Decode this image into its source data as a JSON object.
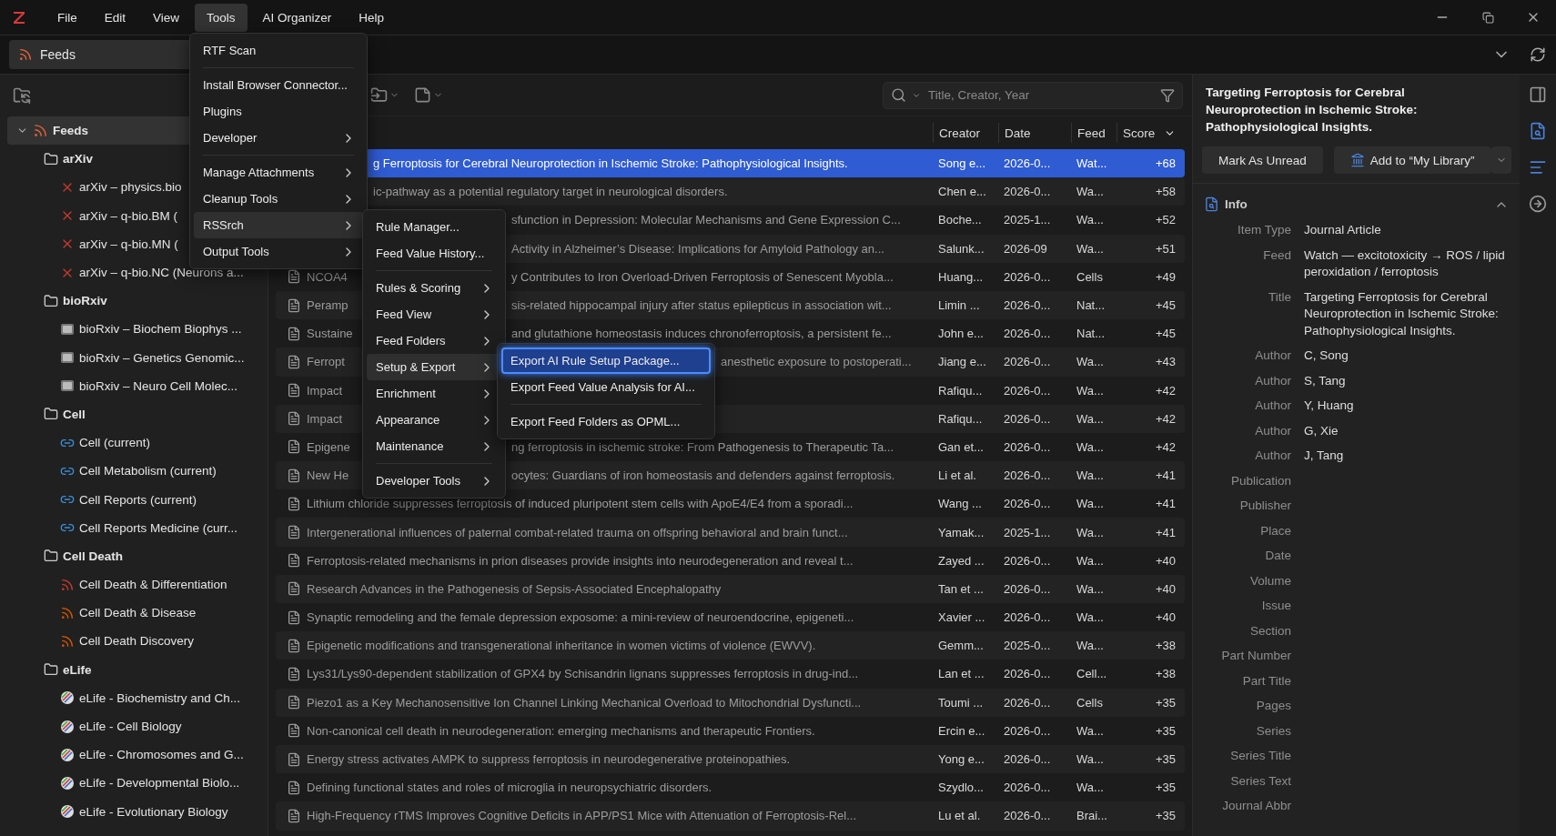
{
  "menu_bar": {
    "items": [
      {
        "label": "File",
        "selected": false
      },
      {
        "label": "Edit",
        "selected": false
      },
      {
        "label": "View",
        "selected": false
      },
      {
        "label": "Tools",
        "selected": true
      },
      {
        "label": "AI Organizer",
        "selected": false
      },
      {
        "label": "Help",
        "selected": false
      }
    ]
  },
  "tab": {
    "label": "Feeds"
  },
  "sidebar": {
    "tree": [
      {
        "label": "Feeds",
        "kind": "root",
        "expanded": true,
        "selected": true,
        "children": [
          {
            "label": "arXiv",
            "kind": "folder",
            "selected": false,
            "children": [
              {
                "label": "arXiv – physics.bio",
                "kind": "arxiv",
                "selected": false
              },
              {
                "label": "arXiv – q-bio.BM (",
                "kind": "arxiv",
                "selected": false
              },
              {
                "label": "arXiv – q-bio.MN (",
                "kind": "arxiv",
                "selected": false
              },
              {
                "label": "arXiv – q-bio.NC (Neurons a...",
                "kind": "arxiv",
                "selected": false
              }
            ]
          },
          {
            "label": "bioRxiv",
            "kind": "folder",
            "selected": false,
            "children": [
              {
                "label": "bioRxiv – Biochem Biophys ...",
                "kind": "biorxiv",
                "selected": false
              },
              {
                "label": "bioRxiv – Genetics Genomic...",
                "kind": "biorxiv",
                "selected": false
              },
              {
                "label": "bioRxiv – Neuro Cell Molec...",
                "kind": "biorxiv",
                "selected": false
              }
            ]
          },
          {
            "label": "Cell",
            "kind": "folder",
            "selected": false,
            "children": [
              {
                "label": "Cell (current)",
                "kind": "journal",
                "selected": false
              },
              {
                "label": "Cell Metabolism (current)",
                "kind": "journal",
                "selected": false
              },
              {
                "label": "Cell Reports (current)",
                "kind": "journal",
                "selected": false
              },
              {
                "label": "Cell Reports Medicine (curr...",
                "kind": "journal",
                "selected": false
              }
            ]
          },
          {
            "label": "Cell Death",
            "kind": "folder",
            "selected": false,
            "children": [
              {
                "label": "Cell Death & Differentiation",
                "kind": "rss",
                "color": "#c0392b",
                "selected": false
              },
              {
                "label": "Cell Death & Disease",
                "kind": "rss",
                "color": "#d35400",
                "selected": false
              },
              {
                "label": "Cell Death Discovery",
                "kind": "rss",
                "color": "#d35400",
                "selected": false
              }
            ]
          },
          {
            "label": "eLife",
            "kind": "folder",
            "selected": false,
            "children": [
              {
                "label": "eLife - Biochemistry and Ch...",
                "kind": "elife",
                "selected": false
              },
              {
                "label": "eLife - Cell Biology",
                "kind": "elife",
                "selected": false
              },
              {
                "label": "eLife - Chromosomes and G...",
                "kind": "elife",
                "selected": false
              },
              {
                "label": "eLife - Developmental Biolo...",
                "kind": "elife",
                "selected": false
              },
              {
                "label": "eLife - Evolutionary Biology",
                "kind": "elife",
                "selected": false
              }
            ]
          }
        ]
      }
    ]
  },
  "search": {
    "placeholder": "Title, Creator, Year"
  },
  "table": {
    "columns": [
      "Creator",
      "Date",
      "Feed",
      "Score"
    ],
    "rows": [
      {
        "title_end": "g Ferroptosis for Cerebral Neuroprotection in Ischemic Stroke: Pathophysiological Insights.",
        "creator": "Song e...",
        "date": "2026-0...",
        "feed": "Wat...",
        "score": "+68",
        "selected": true
      },
      {
        "title_end": "ic-pathway as a potential regulatory target in neurological disorders.",
        "creator": "Chen e...",
        "date": "2026-0...",
        "feed": "Wa...",
        "score": "+58",
        "selected": false
      },
      {
        "title_end": "sfunction in Depression: Molecular Mechanisms and Gene Expression C...",
        "creator": "Boche...",
        "date": "2025-1...",
        "feed": "Wa...",
        "score": "+52",
        "selected": false
      },
      {
        "title_end": "Activity in Alzheimer’s Disease: Implications for Amyloid Pathology an...",
        "creator": "Salunk...",
        "date": "2026-09",
        "feed": "Wa...",
        "score": "+51",
        "selected": false
      },
      {
        "title_start": "NCOA4",
        "title_end": "y Contributes to Iron Overload-Driven Ferroptosis of Senescent Myobla...",
        "creator": "Huang...",
        "date": "2026-0...",
        "feed": "Cells",
        "score": "+49",
        "selected": false
      },
      {
        "title_start": "Peramp",
        "title_end": "sis-related hippocampal injury after status epilepticus in association wit...",
        "creator": "Limin ...",
        "date": "2026-0...",
        "feed": "Nat...",
        "score": "+45",
        "selected": false
      },
      {
        "title_start": "Sustaine",
        "title_end": "and glutathione homeostasis induces chronoferroptosis, a persistent fe...",
        "creator": "John e...",
        "date": "2026-0...",
        "feed": "Nat...",
        "score": "+45",
        "selected": false
      },
      {
        "title_start": "Ferropt",
        "title_end": "anesthetic exposure to postoperati...",
        "creator": "Jiang e...",
        "date": "2026-0...",
        "feed": "Wa...",
        "score": "+43",
        "selected": false
      },
      {
        "title_start": "Impact",
        "creator": "Rafiqu...",
        "date": "2026-0...",
        "feed": "Wa...",
        "score": "+42",
        "selected": false
      },
      {
        "title_start": "Impact",
        "creator": "Rafiqu...",
        "date": "2026-0...",
        "feed": "Wa...",
        "score": "+42",
        "selected": false
      },
      {
        "title_start": "Epigene",
        "title_end": "ng ferroptosis in ischemic stroke: From Pathogenesis to Therapeutic Ta...",
        "creator": "Gan et...",
        "date": "2026-0...",
        "feed": "Wa...",
        "score": "+42",
        "selected": false
      },
      {
        "title_start": "New He",
        "title_end": "ocytes: Guardians of iron homeostasis and defenders against ferroptosis.",
        "creator": "Li et al.",
        "date": "2026-0...",
        "feed": "Wa...",
        "score": "+41",
        "selected": false
      },
      {
        "title": "Lithium chloride suppresses ferroptosis of induced pluripotent stem cells with ApoE4/E4 from a sporadi...",
        "creator": "Wang ...",
        "date": "2026-0...",
        "feed": "Wa...",
        "score": "+41",
        "selected": false
      },
      {
        "title": "Intergenerational influences of paternal combat-related trauma on offspring behavioral and brain funct...",
        "creator": "Yamak...",
        "date": "2025-1...",
        "feed": "Wa...",
        "score": "+41",
        "selected": false
      },
      {
        "title": "Ferroptosis-related mechanisms in prion diseases provide insights into neurodegeneration and reveal t...",
        "creator": "Zayed ...",
        "date": "2026-0...",
        "feed": "Wa...",
        "score": "+40",
        "selected": false
      },
      {
        "title": "Research Advances in the Pathogenesis of Sepsis-Associated Encephalopathy",
        "creator": "Tan et ...",
        "date": "2026-0...",
        "feed": "Wa...",
        "score": "+40",
        "selected": false
      },
      {
        "title": "Synaptic remodeling and the female depression exposome: a mini-review of neuroendocrine, epigeneti...",
        "creator": "Xavier ...",
        "date": "2026-0...",
        "feed": "Wa...",
        "score": "+40",
        "selected": false
      },
      {
        "title": "Epigenetic modifications and transgenerational inheritance in women victims of violence (EWVV).",
        "creator": "Gemm...",
        "date": "2025-0...",
        "feed": "Wa...",
        "score": "+38",
        "selected": false
      },
      {
        "title": "Lys31/Lys90-dependent stabilization of GPX4 by Schisandrin lignans suppresses ferroptosis in drug-ind...",
        "creator": "Lan et ...",
        "date": "2026-0...",
        "feed": "Cell...",
        "score": "+38",
        "selected": false
      },
      {
        "title": "Piezo1 as a Key Mechanosensitive Ion Channel Linking Mechanical Overload to Mitochondrial Dysfuncti...",
        "creator": "Toumi ...",
        "date": "2026-0...",
        "feed": "Cells",
        "score": "+35",
        "selected": false
      },
      {
        "title": "Non-canonical cell death in neurodegeneration: emerging mechanisms and therapeutic Frontiers.",
        "creator": "Ercin e...",
        "date": "2026-0...",
        "feed": "Wa...",
        "score": "+35",
        "selected": false
      },
      {
        "title": "Energy stress activates AMPK to suppress ferroptosis in neurodegenerative proteinopathies.",
        "creator": "Yong e...",
        "date": "2026-0...",
        "feed": "Wa...",
        "score": "+35",
        "selected": false
      },
      {
        "title": "Defining functional states and roles of microglia in neuropsychiatric disorders.",
        "creator": "Szydlo...",
        "date": "2026-0...",
        "feed": "Wa...",
        "score": "+35",
        "selected": false
      },
      {
        "title": "High-Frequency rTMS Improves Cognitive Deficits in APP/PS1 Mice with Attenuation of Ferroptosis-Rel...",
        "creator": "Lu et al.",
        "date": "2026-0...",
        "feed": "Brai...",
        "score": "+35",
        "selected": false
      }
    ]
  },
  "item_pane": {
    "title": "Targeting Ferroptosis for Cerebral Neuroprotection in Ischemic Stroke: Pathophysiological Insights.",
    "mark_button": "Mark As Unread",
    "add_button": "Add to “My Library”",
    "section": "Info",
    "fields": [
      {
        "label": "Item Type",
        "value": "Journal Article"
      },
      {
        "label": "Feed",
        "value": "Watch — excitotoxicity → ROS / lipid peroxidation / ferroptosis"
      },
      {
        "label": "Title",
        "value": "Targeting Ferroptosis for Cerebral Neuroprotection in Ischemic Stroke: Pathophysiological Insights."
      },
      {
        "label": "Author",
        "value": "C, Song"
      },
      {
        "label": "Author",
        "value": "S, Tang"
      },
      {
        "label": "Author",
        "value": "Y, Huang"
      },
      {
        "label": "Author",
        "value": "G, Xie"
      },
      {
        "label": "Author",
        "value": "J, Tang"
      },
      {
        "label": "Publication"
      },
      {
        "label": "Publisher"
      },
      {
        "label": "Place"
      },
      {
        "label": "Date"
      },
      {
        "label": "Volume"
      },
      {
        "label": "Issue"
      },
      {
        "label": "Section"
      },
      {
        "label": "Part Number"
      },
      {
        "label": "Part Title"
      },
      {
        "label": "Pages"
      },
      {
        "label": "Series"
      },
      {
        "label": "Series Title"
      },
      {
        "label": "Series Text"
      },
      {
        "label": "Journal Abbr"
      }
    ]
  },
  "menus": [
    {
      "groups": [
        [
          {
            "label": "RTF Scan",
            "submenu": false,
            "selected": false
          }
        ],
        [
          {
            "label": "Install Browser Connector...",
            "submenu": false,
            "selected": false
          },
          {
            "label": "Plugins",
            "submenu": false,
            "selected": false
          },
          {
            "label": "Developer",
            "submenu": true,
            "selected": false
          }
        ],
        [
          {
            "label": "Manage Attachments",
            "submenu": true,
            "selected": false
          },
          {
            "label": "Cleanup Tools",
            "submenu": true,
            "selected": false
          },
          {
            "label": "RSSrch",
            "submenu": true,
            "selected": true
          },
          {
            "label": "Output Tools",
            "submenu": true,
            "selected": false
          }
        ]
      ]
    },
    {
      "groups": [
        [
          {
            "label": "Rule Manager...",
            "submenu": false,
            "selected": false
          },
          {
            "label": "Feed Value History...",
            "submenu": false,
            "selected": false
          }
        ],
        [
          {
            "label": "Rules & Scoring",
            "submenu": true,
            "selected": false
          },
          {
            "label": "Feed View",
            "submenu": true,
            "selected": false
          },
          {
            "label": "Feed Folders",
            "submenu": true,
            "selected": false
          },
          {
            "label": "Setup & Export",
            "submenu": true,
            "selected": true
          },
          {
            "label": "Enrichment",
            "submenu": true,
            "selected": false
          },
          {
            "label": "Appearance",
            "submenu": true,
            "selected": false
          },
          {
            "label": "Maintenance",
            "submenu": true,
            "selected": false
          }
        ],
        [
          {
            "label": "Developer Tools",
            "submenu": true,
            "selected": false
          }
        ]
      ]
    },
    {
      "groups": [
        [
          {
            "label": "Export AI Rule Setup Package...",
            "submenu": false,
            "selected": true
          },
          {
            "label": "Export Feed Value Analysis for AI...",
            "submenu": false,
            "selected": false
          }
        ],
        [
          {
            "label": "Export Feed Folders as OPML...",
            "submenu": false,
            "selected": false
          }
        ]
      ]
    }
  ]
}
